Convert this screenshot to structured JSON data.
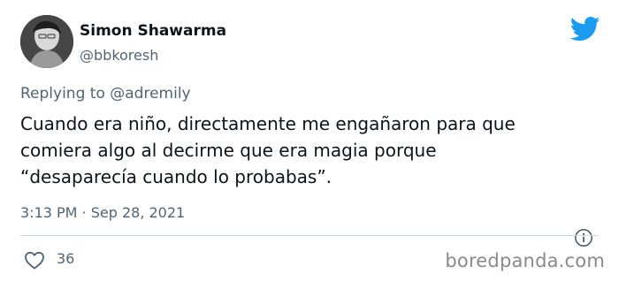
{
  "author": {
    "display_name": "Simon Shawarma",
    "handle": "@bbkoresh"
  },
  "reply": {
    "prefix": "Replying to",
    "mention": "@adremily"
  },
  "tweet": {
    "lines": [
      "Cuando era niño, directamente me engañaron para que",
      "comiera algo al decirme que era magia porque",
      "“desaparecía cuando lo probabas”."
    ]
  },
  "meta": {
    "timestamp": "3:13 PM · Sep 28, 2021"
  },
  "engagement": {
    "likes": "36"
  },
  "watermark": "boredpanda.com",
  "colors": {
    "twitter_blue": "#1d9bf0",
    "secondary_text": "#536471",
    "primary_text": "#0f1419"
  },
  "icons": {
    "brand": "twitter-bird-icon",
    "info": "info-icon",
    "like": "heart-icon"
  }
}
